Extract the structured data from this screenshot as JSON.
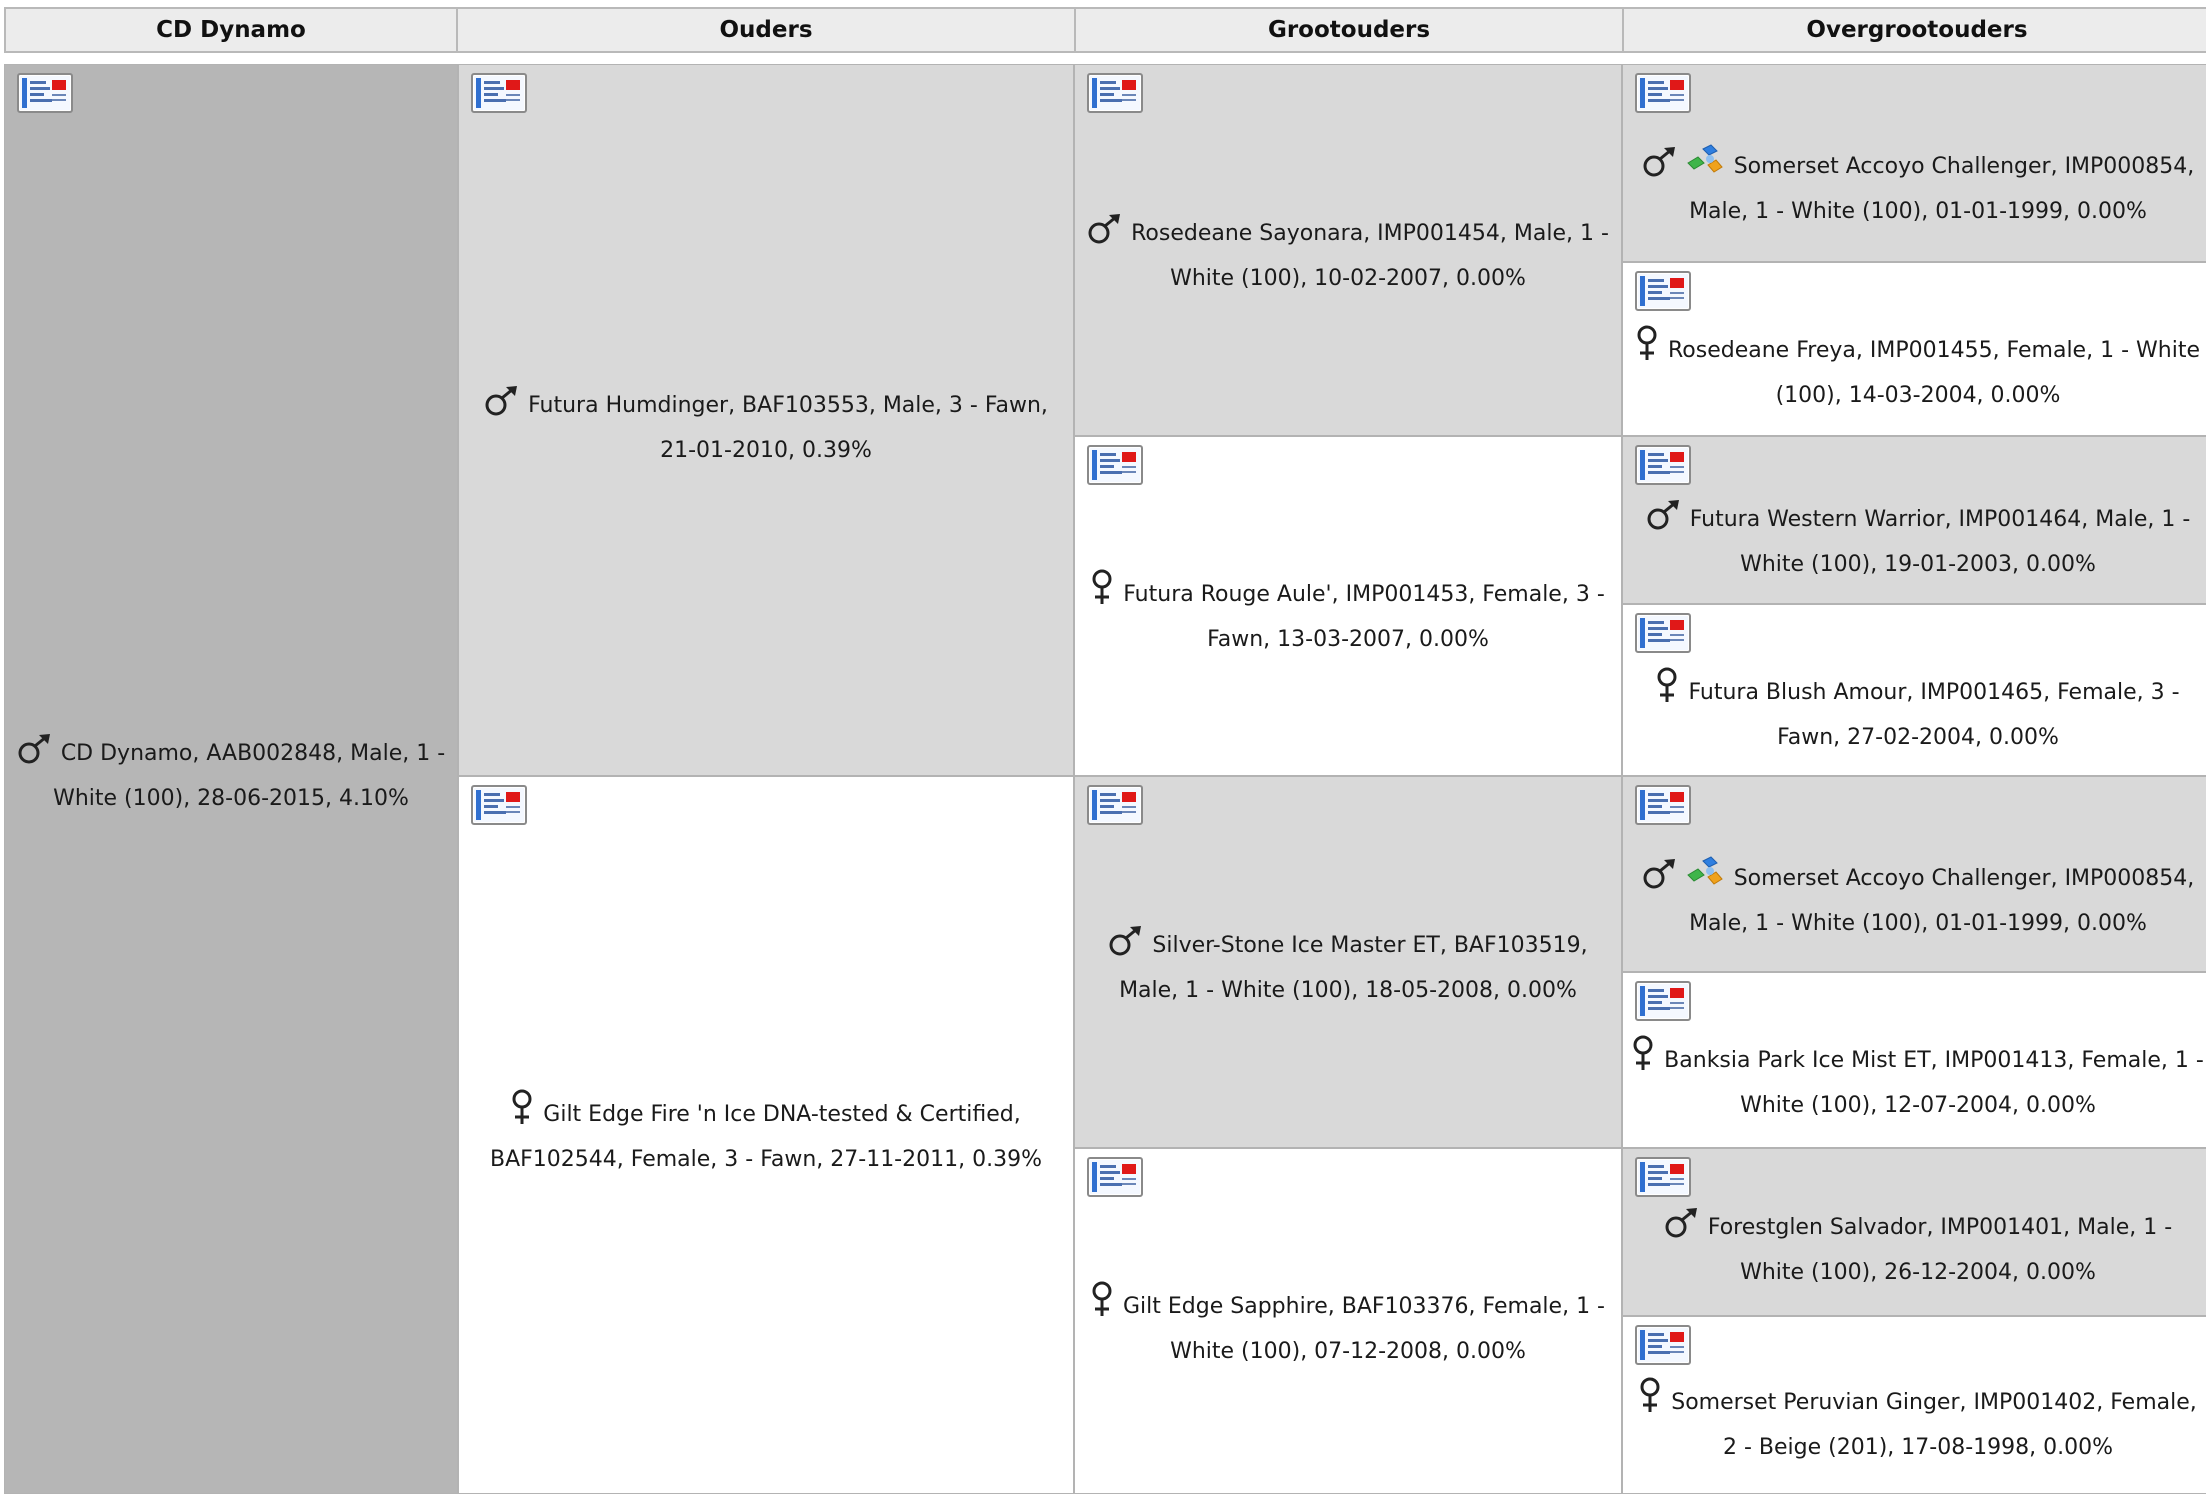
{
  "headers": [
    "CD Dynamo",
    "Ouders",
    "Grootouders",
    "Overgrootouders"
  ],
  "animals": {
    "subject": {
      "sex": "male",
      "name": "CD Dynamo",
      "rest": ", AAB002848, Male, 1 - White (100), 28-06-2015, 4.10%"
    },
    "sire": {
      "sex": "male",
      "name": "Futura Humdinger",
      "rest": ", BAF103553, Male, 3 - Fawn, 21-01-2010, 0.39%"
    },
    "dam": {
      "sex": "female",
      "name": "Gilt Edge Fire 'n Ice DNA-tested & Certified",
      "rest": ", BAF102544, Female, 3 - Fawn, 27-11-2011, 0.39%"
    },
    "ss": {
      "sex": "male",
      "name": "Rosedeane Sayonara",
      "rest": ", IMP001454, Male, 1 - White (100), 10-02-2007, 0.00%"
    },
    "sd": {
      "sex": "female",
      "name": "Futura Rouge Aule'",
      "rest": ", IMP001453, Female, 3 - Fawn, 13-03-2007, 0.00%"
    },
    "ds": {
      "sex": "male",
      "name": "Silver-Stone Ice Master ET",
      "rest": ", BAF103519, Male, 1 - White (100), 18-05-2008, 0.00%"
    },
    "dd": {
      "sex": "female",
      "name": "Gilt Edge Sapphire",
      "rest": ", BAF103376, Female, 1 - White (100), 07-12-2008, 0.00%"
    },
    "sss": {
      "sex": "male",
      "links": true,
      "name": "Somerset Accoyo Challenger",
      "rest": ", IMP000854, Male, 1 - White (100), 01-01-1999, 0.00%"
    },
    "ssd": {
      "sex": "female",
      "name": "Rosedeane Freya",
      "rest": ", IMP001455, Female, 1 - White (100), 14-03-2004, 0.00%"
    },
    "sds": {
      "sex": "male",
      "name": "Futura Western Warrior",
      "rest": ", IMP001464, Male, 1 - White (100), 19-01-2003, 0.00%"
    },
    "sdd": {
      "sex": "female",
      "name": "Futura Blush Amour",
      "rest": ", IMP001465, Female, 3 - Fawn, 27-02-2004, 0.00%"
    },
    "dss": {
      "sex": "male",
      "links": true,
      "name": "Somerset Accoyo Challenger",
      "rest": ", IMP000854, Male, 1 - White (100), 01-01-1999, 0.00%"
    },
    "dsd": {
      "sex": "female",
      "name": "Banksia Park Ice Mist ET",
      "rest": ", IMP001413, Female, 1 - White (100), 12-07-2004, 0.00%"
    },
    "dds": {
      "sex": "male",
      "name": "Forestglen Salvador",
      "rest": ", IMP001401, Male, 1 - White (100), 26-12-2004, 0.00%"
    },
    "ddd": {
      "sex": "female",
      "name": "Somerset Peruvian Ginger",
      "rest": ", IMP001402, Female, 2 - Beige (201), 17-08-1998, 0.00%"
    }
  },
  "icons": {
    "card": "animal-card-icon",
    "male": "male-symbol-icon",
    "female": "female-symbol-icon",
    "links": "pedigree-link-icon"
  },
  "colors": {
    "subject_bg": "#b6b6b6",
    "male_bg": "#d9d9d9",
    "female_bg": "#ffffff",
    "header_bg": "#ececec",
    "border": "#b3b3b3"
  }
}
